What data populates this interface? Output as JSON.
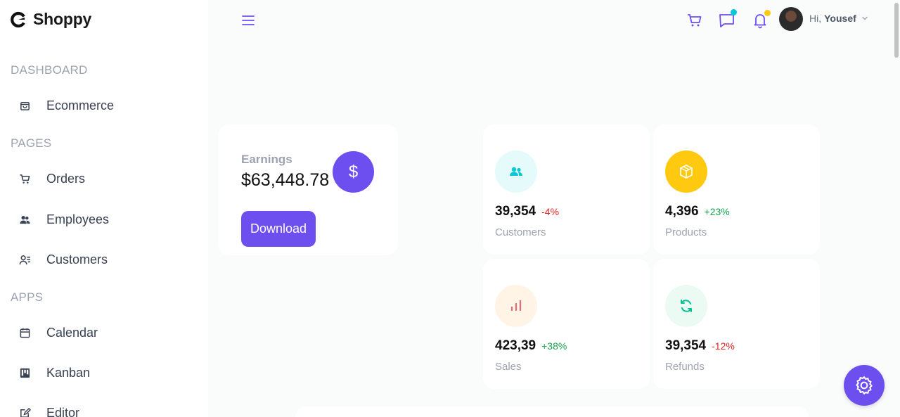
{
  "brand": {
    "name": "Shoppy",
    "logo_icon": "shoppy-logo-icon"
  },
  "sidebar": {
    "sections": [
      {
        "title": "DASHBOARD",
        "items": [
          {
            "label": "Ecommerce",
            "icon": "shopping-bag-icon"
          }
        ]
      },
      {
        "title": "PAGES",
        "items": [
          {
            "label": "Orders",
            "icon": "cart-icon"
          },
          {
            "label": "Employees",
            "icon": "users-icon"
          },
          {
            "label": "Customers",
            "icon": "user-list-icon"
          }
        ]
      },
      {
        "title": "APPS",
        "items": [
          {
            "label": "Calendar",
            "icon": "calendar-icon"
          },
          {
            "label": "Kanban",
            "icon": "kanban-icon"
          },
          {
            "label": "Editor",
            "icon": "edit-icon"
          }
        ]
      }
    ]
  },
  "topbar": {
    "menu_icon": "hamburger-menu-icon",
    "greeting": "Hi,",
    "user_name": "Yousef",
    "chat_dot_color": "#03c9d7",
    "notification_dot_color": "#fec90f"
  },
  "earnings": {
    "label": "Earnings",
    "value": "$63,448.78",
    "icon_symbol": "$",
    "button_label": "Download"
  },
  "stats": [
    {
      "value": "39,354",
      "change": "-4%",
      "change_color": "#dc2626",
      "label": "Customers",
      "icon": "customers-icon",
      "icon_color": "#03c9d7",
      "icon_bg": "#e5fafb"
    },
    {
      "value": "4,396",
      "change": "+23%",
      "change_color": "#16a34a",
      "label": "Products",
      "icon": "box-icon",
      "icon_color": "#ffffff",
      "icon_bg": "#fec90f"
    },
    {
      "value": "423,39",
      "change": "+38%",
      "change_color": "#16a34a",
      "label": "Sales",
      "icon": "bar-chart-icon",
      "icon_color": "#e46a76",
      "icon_bg": "#fff4e5"
    },
    {
      "value": "39,354",
      "change": "-12%",
      "change_color": "#dc2626",
      "label": "Refunds",
      "icon": "refresh-icon",
      "icon_color": "#00c292",
      "icon_bg": "#ebfaf2"
    }
  ],
  "accent_color": "#6d4ff0"
}
